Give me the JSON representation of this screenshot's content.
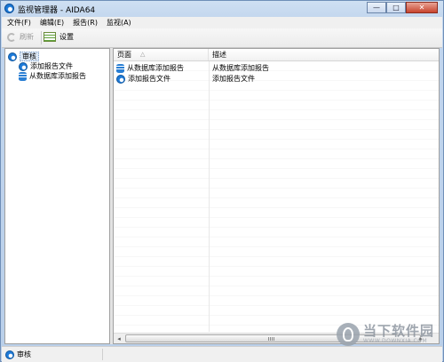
{
  "window": {
    "title": "监视管理器 - AIDA64"
  },
  "window_buttons": {
    "minimize": "—",
    "maximize": "□",
    "close": "✕"
  },
  "menu": {
    "items": [
      "文件(F)",
      "编辑(E)",
      "报告(R)",
      "监视(A)"
    ]
  },
  "toolbar": {
    "refresh_label": "刷新",
    "settings_label": "设置"
  },
  "tree": {
    "root": "审核",
    "children": [
      "添加报告文件",
      "从数据库添加报告"
    ]
  },
  "table": {
    "columns": [
      "页面",
      "描述"
    ],
    "sort_indicator": "△",
    "rows": [
      {
        "page": "从数据库添加报告",
        "desc": "从数据库添加报告",
        "icon": "db-icon"
      },
      {
        "page": "添加报告文件",
        "desc": "添加报告文件",
        "icon": "globe-icon"
      }
    ]
  },
  "scrollbar": {
    "left_arrow": "◂",
    "right_arrow": "▸"
  },
  "status": {
    "text": "审核"
  },
  "watermark": {
    "name": "当下软件园",
    "url": "WWW.DOWNXIA.COM"
  }
}
